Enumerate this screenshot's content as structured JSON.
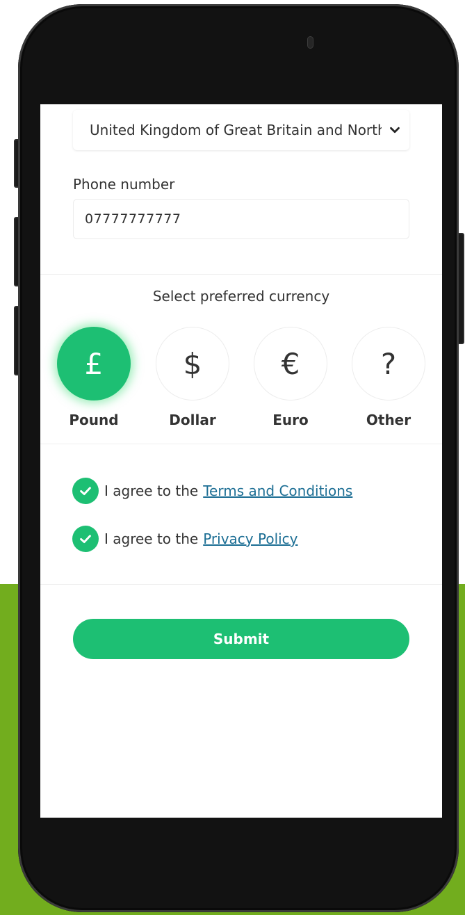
{
  "form": {
    "country_value": "United Kingdom of Great Britain and Northern Ireland",
    "phone_label": "Phone number",
    "phone_value": "07777777777"
  },
  "currency": {
    "title": "Select preferred currency",
    "selected": "Pound",
    "options": [
      {
        "symbol": "£",
        "label": "Pound",
        "icon": "pound-icon"
      },
      {
        "symbol": "$",
        "label": "Dollar",
        "icon": "dollar-icon"
      },
      {
        "symbol": "€",
        "label": "Euro",
        "icon": "euro-icon"
      },
      {
        "symbol": "?",
        "label": "Other",
        "icon": "question-icon"
      }
    ]
  },
  "agreements": [
    {
      "prefix": "I agree to the",
      "link": "Terms and Conditions",
      "checked": true
    },
    {
      "prefix": "I agree to the",
      "link": "Privacy Policy",
      "checked": true
    }
  ],
  "submit_label": "Submit",
  "colors": {
    "accent": "#1dbf73",
    "background_band": "#72ad1e",
    "link": "#1c6e94"
  }
}
